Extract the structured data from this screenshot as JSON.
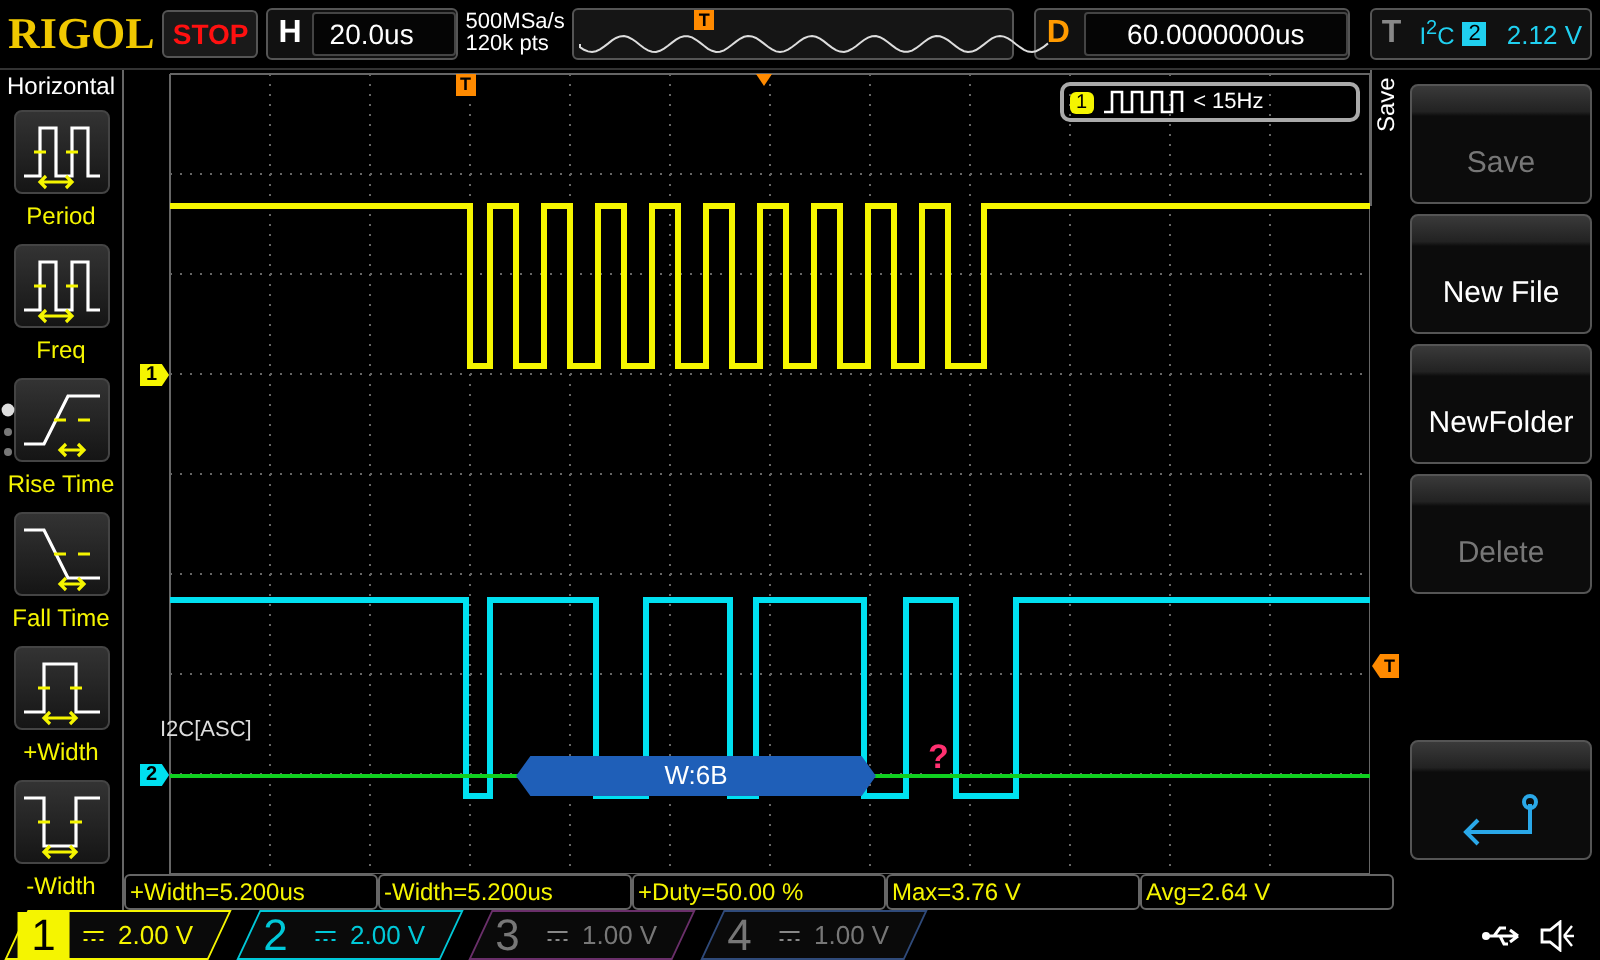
{
  "top_bar": {
    "logo": "RIGOL",
    "run_state": "STOP",
    "timebase": {
      "label": "H",
      "value": "20.0us"
    },
    "sample_rate": "500MSa/s",
    "memory_depth": "120k pts",
    "overview_trigger_marker": "T",
    "delay": {
      "label": "D",
      "value": "60.0000000us"
    },
    "trigger": {
      "label": "T",
      "type": "I$^{2}$C",
      "source": "2",
      "threshold": "2.12 V"
    }
  },
  "side_menu": {
    "title": "Horizontal",
    "items": [
      {
        "label": "Period"
      },
      {
        "label": "Freq"
      },
      {
        "label": "Rise Time"
      },
      {
        "label": "Fall Time"
      },
      {
        "label": "+Width"
      },
      {
        "label": "-Width"
      }
    ]
  },
  "scope": {
    "trigger_marker": "T",
    "channel_markers": [
      {
        "label": "1",
        "color": "#f5f500"
      },
      {
        "label": "2",
        "color": "#00e0f0"
      }
    ],
    "decoder_label": "I2C[ASC]",
    "packet": "W:6B",
    "error_mark": "?",
    "frequency_readout": {
      "channel": "1",
      "value": "< 15Hz"
    },
    "trigger_level_marker": "T"
  },
  "soft_menu": {
    "tab": "Save",
    "buttons": [
      {
        "kind": "text",
        "label": "Save",
        "disabled": true
      },
      {
        "kind": "text",
        "label": "New File",
        "disabled": false
      },
      {
        "kind": "text",
        "label": "NewFolder",
        "disabled": false
      },
      {
        "kind": "text",
        "label": "Delete",
        "disabled": true
      },
      {
        "kind": "back"
      }
    ]
  },
  "measurements": [
    "+Width=5.200us",
    "-Width=5.200us",
    "+Duty=50.00 %",
    "Max=3.76 V",
    "Avg=2.64 V"
  ],
  "channels": [
    {
      "number": "1",
      "scale": "2.00 V",
      "selected": true,
      "on": true,
      "color": "#f5f500"
    },
    {
      "number": "2",
      "scale": "2.00 V",
      "selected": false,
      "on": true,
      "color": "#00c8d8"
    },
    {
      "number": "3",
      "scale": "1.00 V",
      "selected": false,
      "on": false,
      "color": "#6a2f6a"
    },
    {
      "number": "4",
      "scale": "1.00 V",
      "selected": false,
      "on": false,
      "color": "#2f4a7a"
    }
  ]
}
